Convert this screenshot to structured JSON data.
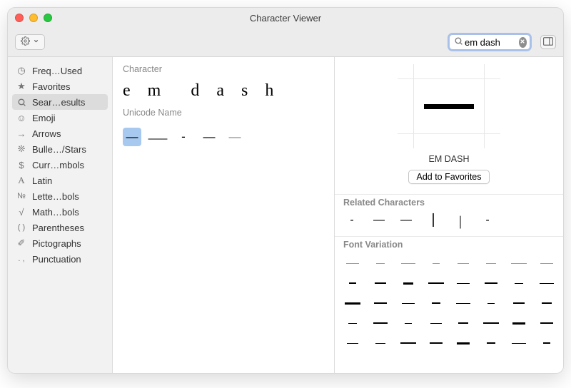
{
  "window": {
    "title": "Character Viewer"
  },
  "toolbar": {
    "settings_icon": "gear-icon",
    "dropdown_icon": "chevron-down-icon",
    "sidebar_icon": "panel-right-icon"
  },
  "search": {
    "value": "em dash",
    "clear_icon": "x-circle-icon",
    "search_icon": "search-icon"
  },
  "sidebar": {
    "items": [
      {
        "icon": "clock-icon",
        "label": "Freq…Used",
        "selected": false
      },
      {
        "icon": "star-icon",
        "label": "Favorites",
        "selected": false
      },
      {
        "icon": "magnify-icon",
        "label": "Sear…esults",
        "selected": true
      },
      {
        "icon": "smile-icon",
        "label": "Emoji",
        "selected": false
      },
      {
        "icon": "arrow-icon",
        "label": "Arrows",
        "selected": false
      },
      {
        "icon": "asterisk-icon",
        "label": "Bulle…/Stars",
        "selected": false
      },
      {
        "icon": "dollar-icon",
        "label": "Curr…mbols",
        "selected": false
      },
      {
        "icon": "letterA-icon",
        "label": "Latin",
        "selected": false
      },
      {
        "icon": "numero-icon",
        "label": "Lette…bols",
        "selected": false
      },
      {
        "icon": "sqrt-icon",
        "label": "Math…bols",
        "selected": false
      },
      {
        "icon": "parens-icon",
        "label": "Parentheses",
        "selected": false
      },
      {
        "icon": "picto-icon",
        "label": "Pictographs",
        "selected": false
      },
      {
        "icon": "punct-icon",
        "label": "Punctuation",
        "selected": false
      }
    ]
  },
  "mid": {
    "character_label": "Character",
    "decomposition": [
      "e",
      "m",
      "",
      "d",
      "a",
      "s",
      "h"
    ],
    "uniname_label": "Unicode Name",
    "candidates": [
      {
        "glyph": "—",
        "selected": true
      },
      {
        "glyph": "⸺",
        "selected": false
      },
      {
        "glyph": "-",
        "selected": false
      },
      {
        "glyph": "—",
        "selected": false
      },
      {
        "glyph": "—",
        "selected": false
      }
    ]
  },
  "detail": {
    "char_name": "EM DASH",
    "fav_button": "Add to Favorites",
    "related_label": "Related Characters",
    "related": [
      "-",
      "—",
      "—",
      "⎮",
      "￨",
      "-"
    ],
    "fontvar_label": "Font Variation",
    "font_variations_rows": 5,
    "font_variations_cols": 8
  }
}
